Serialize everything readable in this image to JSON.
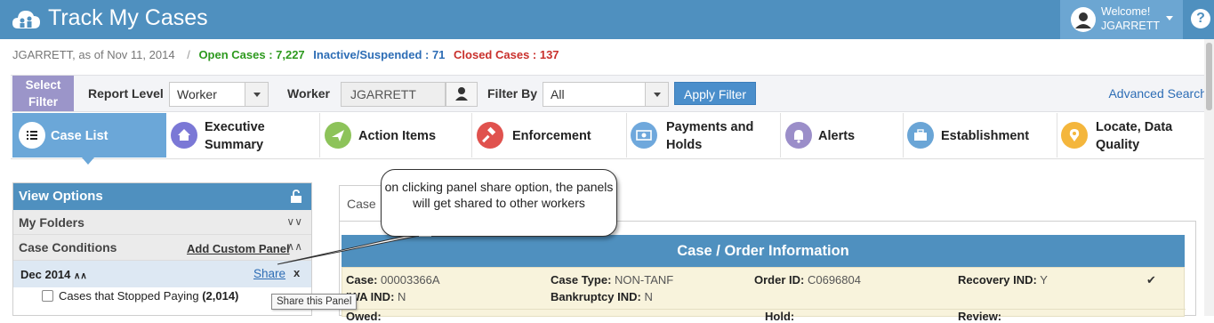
{
  "header": {
    "title": "Track My Cases",
    "welcome": "Welcome!",
    "username": "JGARRETT",
    "help_label": "?"
  },
  "subheader": {
    "user_asof": "JGARRETT, as of Nov 11, 2014",
    "separator": "/",
    "open_cases": "Open Cases : 7,227",
    "inactive": "Inactive/Suspended : 71",
    "closed": "Closed Cases : 137"
  },
  "filter": {
    "select_filter": "Select Filter",
    "report_level_label": "Report Level",
    "report_level_value": "Worker",
    "worker_label": "Worker",
    "worker_value": "JGARRETT",
    "filter_by_label": "Filter By",
    "filter_by_value": "All",
    "apply": "Apply Filter",
    "advanced_search": "Advanced Search"
  },
  "nav": {
    "tabs": [
      {
        "label": "Case List",
        "icon": "list-icon",
        "color": "#ffffff"
      },
      {
        "label": "Executive Summary",
        "icon": "home-icon",
        "color": "#7b78d6"
      },
      {
        "label": "Action Items",
        "icon": "paper-plane-icon",
        "color": "#8dc35a"
      },
      {
        "label": "Enforcement",
        "icon": "gavel-icon",
        "color": "#e0524e"
      },
      {
        "label": "Payments and Holds",
        "icon": "money-icon",
        "color": "#6fa8dc"
      },
      {
        "label": "Alerts",
        "icon": "bell-icon",
        "color": "#9b8ec9"
      },
      {
        "label": "Establishment",
        "icon": "briefcase-icon",
        "color": "#6aa5d6"
      },
      {
        "label": "Locate, Data Quality",
        "icon": "map-marker-icon",
        "color": "#f4b63c"
      }
    ]
  },
  "view_options": {
    "title": "View Options",
    "my_folders": "My Folders",
    "case_conditions": "Case Conditions",
    "add_custom_panel": "Add Custom Panel",
    "panel_title": "Dec 2014",
    "share": "Share",
    "close": "x",
    "item_label": "Cases that Stopped Paying",
    "item_count": "(2,014)"
  },
  "tooltip": "Share this Panel",
  "callout": "on clicking panel share option, the panels will get shared to other workers",
  "case_panel": {
    "tab_label": "Case",
    "header": "Case / Order Information",
    "case_label": "Case:",
    "case_value": "00003366A",
    "case_type_label": "Case Type:",
    "case_type_value": "NON-TANF",
    "order_id_label": "Order ID:",
    "order_id_value": "C0696804",
    "recovery_label": "Recovery IND:",
    "recovery_value": "Y",
    "iwa_label": "IWA IND:",
    "iwa_value": "N",
    "bankruptcy_label": "Bankruptcy IND:",
    "bankruptcy_value": "N",
    "owed_label": "Owed:",
    "hold_label": "Hold:",
    "review_label": "Review:"
  }
}
